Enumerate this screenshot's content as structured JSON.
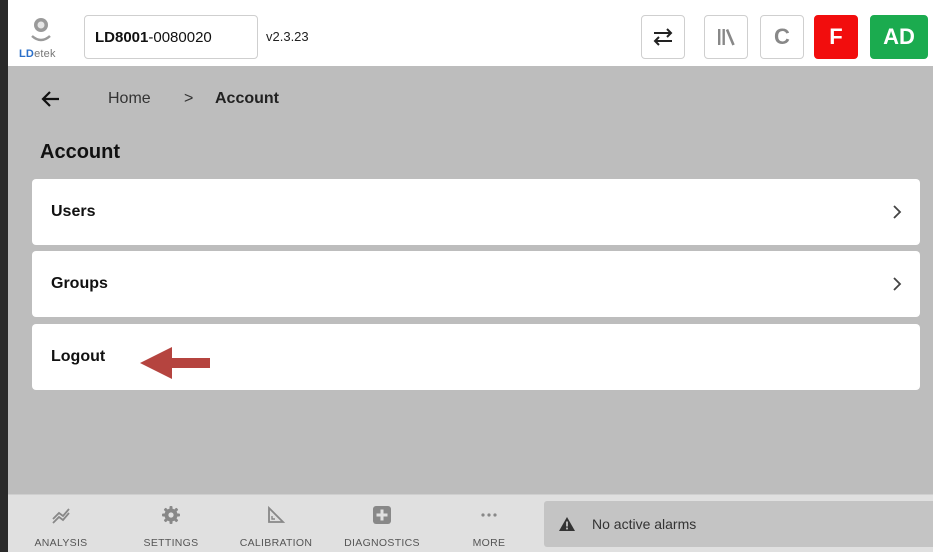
{
  "header": {
    "logo_ld": "LD",
    "logo_etek": "etek",
    "device_model": "LD8001",
    "device_serial": "-0080020",
    "version": "v2.3.23",
    "c_label": "C",
    "f_label": "F",
    "ad_label": "AD",
    "colors": {
      "f_bg": "#f20d0d",
      "ad_bg": "#1bab4f"
    }
  },
  "breadcrumb": {
    "home": "Home",
    "separator": ">",
    "current": "Account"
  },
  "page": {
    "title": "Account",
    "items": [
      {
        "label": "Users",
        "has_chevron": true
      },
      {
        "label": "Groups",
        "has_chevron": true
      },
      {
        "label": "Logout",
        "has_chevron": false
      }
    ]
  },
  "nav": {
    "items": [
      {
        "label": "ANALYSIS",
        "icon": "analysis-icon"
      },
      {
        "label": "SETTINGS",
        "icon": "gear-icon"
      },
      {
        "label": "CALIBRATION",
        "icon": "calibration-icon"
      },
      {
        "label": "DIAGNOSTICS",
        "icon": "plus-square-icon"
      },
      {
        "label": "MORE",
        "icon": "more-icon"
      }
    ]
  },
  "alarms": {
    "text": "No active alarms"
  },
  "annotation": {
    "arrow_color": "#b5443f"
  }
}
